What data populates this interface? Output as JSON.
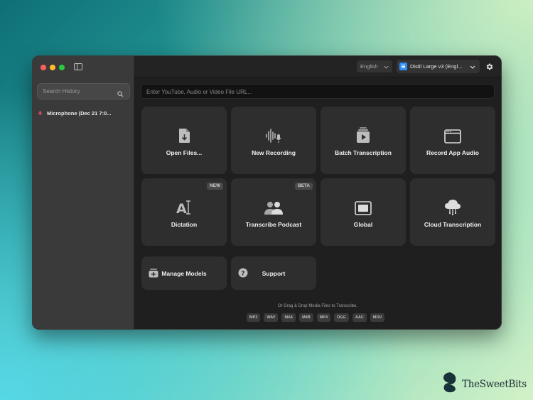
{
  "sidebar": {
    "search_placeholder": "Search History",
    "history": [
      {
        "label": "Microphone (Dec 21 7:0..."
      }
    ]
  },
  "toolbar": {
    "language": "English",
    "model": "Distil Large v3 (Engl..."
  },
  "url_bar": {
    "placeholder": "Enter YouTube, Audio or Video File URL..."
  },
  "tiles": [
    {
      "label": "Open Files...",
      "icon": "file-download-icon"
    },
    {
      "label": "New Recording",
      "icon": "waveform-mic-icon"
    },
    {
      "label": "Batch Transcription",
      "icon": "stacked-play-icon"
    },
    {
      "label": "Record App Audio",
      "icon": "app-window-icon"
    },
    {
      "label": "Dictation",
      "icon": "text-cursor-icon",
      "badge": "NEW"
    },
    {
      "label": "Transcribe Podcast",
      "icon": "people-icon",
      "badge": "BETA"
    },
    {
      "label": "Global",
      "icon": "screen-icon"
    },
    {
      "label": "Cloud Transcription",
      "icon": "cloud-icon"
    }
  ],
  "small_tiles": [
    {
      "label": "Manage Models",
      "icon": "models-add-icon"
    },
    {
      "label": "Support",
      "icon": "question-icon"
    }
  ],
  "drop": {
    "text": "Or Drag & Drop Media Files to Transcribe.",
    "formats": [
      "MP3",
      "WAV",
      "M4A",
      "M4B",
      "MP4",
      "OGG",
      "AAC",
      "MOV"
    ]
  },
  "watermark": {
    "text": "TheSweetBits"
  },
  "colors": {
    "accent_blue": "#2f8ef5",
    "window_bg": "#1f1f1f",
    "tile_bg": "#2e2e2e",
    "sidebar_bg": "#3a3a3b"
  }
}
